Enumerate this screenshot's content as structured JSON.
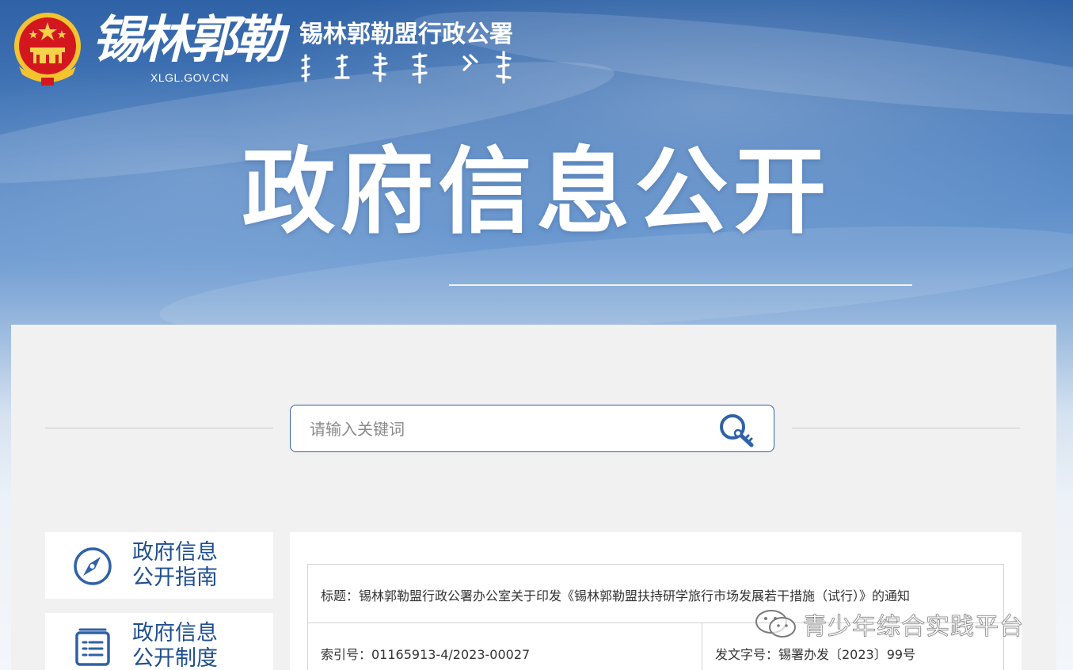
{
  "header": {
    "calligraphy_logo": "锡林郭勒",
    "domain": "XLGL.GOV.CN",
    "org_name": "锡林郭勒盟行政公署",
    "hero_title": "政府信息公开"
  },
  "search": {
    "placeholder": "请输入关键词",
    "value": ""
  },
  "sidebar": {
    "items": [
      {
        "line1": "政府信息",
        "line2": "公开指南",
        "icon": "compass-icon"
      },
      {
        "line1": "政府信息",
        "line2": "公开制度",
        "icon": "document-list-icon"
      }
    ]
  },
  "document": {
    "title": "标题：锡林郭勒盟行政公署办公室关于印发《锡林郭勒盟扶持研学旅行市场发展若干措施（试行）》的通知",
    "index_no": "索引号：01165913-4/2023-00027",
    "doc_no": "发文字号：锡署办发〔2023〕99号"
  },
  "watermark": {
    "text": "青少年综合实践平台",
    "icon": "wechat-icon"
  },
  "colors": {
    "brand_blue": "#2f62a6",
    "sidebar_text": "#1f4f8f",
    "panel_bg": "#f1f1f1"
  }
}
